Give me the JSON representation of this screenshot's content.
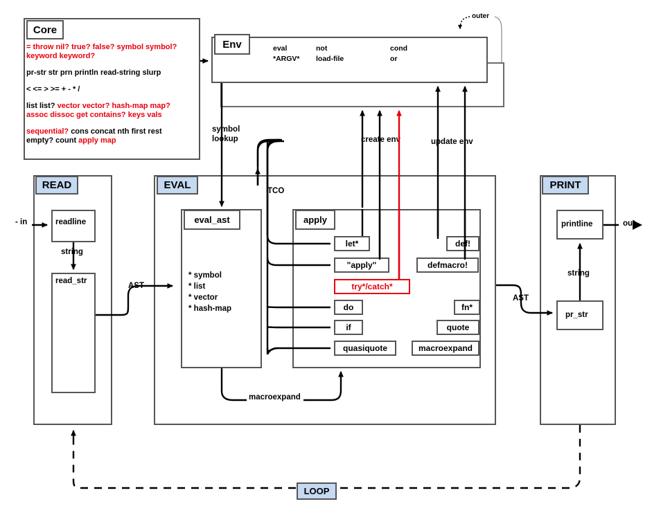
{
  "diagram": {
    "title_core": "Core",
    "title_env": "Env",
    "label_outer": "outer",
    "label_in": "- in",
    "label_out": "out",
    "label_loop": "LOOP"
  },
  "core": {
    "lines": [
      [
        {
          "t": "= throw nil? true? false? symbol symbol? keyword keyword?",
          "c": "red"
        }
      ],
      [
        {
          "t": "pr-str str prn println read-string slurp",
          "c": "black"
        }
      ],
      [
        {
          "t": "< <= > >= + - * /",
          "c": "black"
        }
      ],
      [
        {
          "t": "list list? ",
          "c": "black"
        },
        {
          "t": "vector vector? hash-map map? assoc dissoc get contains? keys vals",
          "c": "red"
        }
      ],
      [
        {
          "t": "sequential? ",
          "c": "red"
        },
        {
          "t": "cons concat nth first rest empty? count ",
          "c": "black"
        },
        {
          "t": "apply map",
          "c": "red"
        }
      ]
    ]
  },
  "env": {
    "col1": [
      "eval",
      "*ARGV*"
    ],
    "col2": [
      "not",
      "load-file"
    ],
    "col3": [
      "cond",
      "or"
    ]
  },
  "sections": {
    "read": "READ",
    "eval": "EVAL",
    "print": "PRINT"
  },
  "read_section": {
    "readline": "readline",
    "read_str": "read_str",
    "edge_string": "string",
    "edge_ast": "AST"
  },
  "eval_section": {
    "eval_ast": "eval_ast",
    "eval_ast_items": [
      "* symbol",
      "* list",
      "* vector",
      "* hash-map"
    ],
    "apply": "apply",
    "tco": "TCO",
    "macroexpand_edge": "macroexpand",
    "special_forms_left": [
      "let*",
      "\"apply\"",
      "try*/catch*",
      "do",
      "if",
      "quasiquote"
    ],
    "special_forms_right": [
      "def!",
      "defmacro!",
      "fn*",
      "quote",
      "macroexpand"
    ],
    "edge_ast": "AST"
  },
  "print_section": {
    "printline": "printline",
    "pr_str": "pr_str",
    "edge_string": "string"
  },
  "edges": {
    "symbol_lookup": "symbol lookup",
    "symbol_lookup_l1": "symbol",
    "symbol_lookup_l2": "lookup",
    "create_env": "create env",
    "update_env": "update env"
  },
  "colors": {
    "red": "#e8000d",
    "header_blue": "#c5d9f1",
    "stroke": "#555555",
    "black": "#000000"
  }
}
